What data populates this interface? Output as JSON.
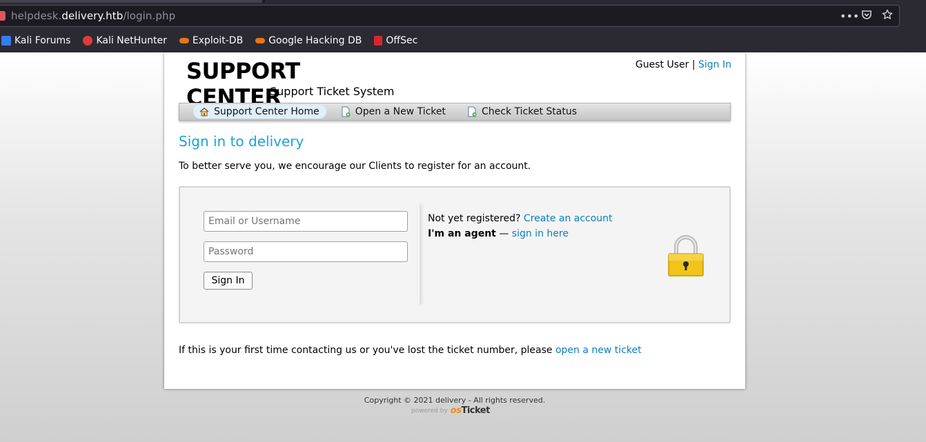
{
  "browser": {
    "url_host_prefix": "helpdesk.",
    "url_host_main": "delivery.htb",
    "url_path": "/login.php",
    "bookmarks": [
      {
        "label": "Kali Forums",
        "icon": "kali-forums-icon",
        "color": "#367bf0"
      },
      {
        "label": "Kali NetHunter",
        "icon": "kali-nethunter-icon",
        "color": "#e23b3b"
      },
      {
        "label": "Exploit-DB",
        "icon": "exploit-db-icon",
        "color": "#e8751a"
      },
      {
        "label": "Google Hacking DB",
        "icon": "ghdb-icon",
        "color": "#e8751a"
      },
      {
        "label": "OffSec",
        "icon": "offsec-icon",
        "color": "#d9262c"
      }
    ]
  },
  "header": {
    "logo_title": "SUPPORT CENTER",
    "logo_subtitle": "Support Ticket System",
    "guest_label": "Guest User",
    "separator": " | ",
    "signin_link": "Sign In"
  },
  "nav": {
    "items": [
      {
        "label": "Support Center Home",
        "icon": "home-icon"
      },
      {
        "label": "Open a New Ticket",
        "icon": "new-ticket-icon"
      },
      {
        "label": "Check Ticket Status",
        "icon": "ticket-status-icon"
      }
    ]
  },
  "main": {
    "title": "Sign in to delivery",
    "intro": "To better serve you, we encourage our Clients to register for an account.",
    "email_placeholder": "Email or Username",
    "password_placeholder": "Password",
    "signin_button": "Sign In",
    "not_registered": "Not yet registered? ",
    "create_account": "Create an account",
    "agent_label": "I'm an agent",
    "agent_dash": " — ",
    "agent_link": "sign in here",
    "footnote_text": "If this is your first time contacting us or you've lost the ticket number, please ",
    "footnote_link": "open a new ticket"
  },
  "footer": {
    "copyright": "Copyright © 2021 delivery - All rights reserved.",
    "powered_by": "powered by",
    "brand_os": "os",
    "brand_ticket": "Ticket"
  },
  "colors": {
    "link": "#0a7ec2",
    "title": "#1aa3d6"
  }
}
